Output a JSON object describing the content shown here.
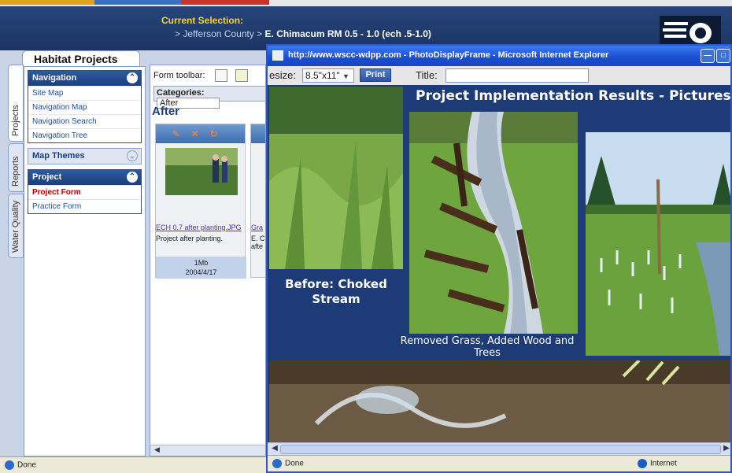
{
  "header": {
    "selection_label": "Current Selection:",
    "path_prefix": "> Jefferson County > ",
    "path_current": "E. Chimacum RM 0.5 - 1.0 (ech .5-1.0)"
  },
  "app": {
    "title_tab": "Habitat Projects",
    "vertical_tabs": [
      "Projects",
      "Reports",
      "Water Quality"
    ],
    "navigation": {
      "header": "Navigation",
      "items": [
        "Site Map",
        "Navigation Map",
        "Navigation Search",
        "Navigation Tree"
      ]
    },
    "map_themes": {
      "header": "Map Themes"
    },
    "project": {
      "header": "Project",
      "items": [
        "Project Form",
        "Practice Form"
      ]
    },
    "form_toolbar_label": "Form toolbar:",
    "categories_label": "Categories:",
    "categories_value": "After",
    "section_title": "After",
    "card": {
      "link": "ECH 0.7 after planting.JPG",
      "description": "Project after planting.",
      "size": "1Mb",
      "date": "2004/4/17"
    },
    "card2": {
      "link": "Gra",
      "description_1": "E. C",
      "description_2": "afte"
    },
    "status": "Done"
  },
  "popup": {
    "window_title": "http://www.wscc-wdpp.com - PhotoDisplayFrame - Microsoft Internet Explorer",
    "size_label": "esize:",
    "size_value": "8.5\"x11\"",
    "print_button": "Print",
    "title_label": "Title:",
    "title_value": "",
    "heading": "Project Implementation Results - Pictures",
    "caption_before_1": "Before: Choked",
    "caption_before_2": "Stream",
    "caption_removed_1": "Removed Grass, Added Wood and",
    "caption_removed_2": "Trees",
    "status_left": "Done",
    "status_right": "Internet"
  },
  "colors": {
    "banner": "#1b3463",
    "accent_yellow": "#f3d23a",
    "nav_blue": "#1b3f7c",
    "red_link": "#c00000"
  }
}
